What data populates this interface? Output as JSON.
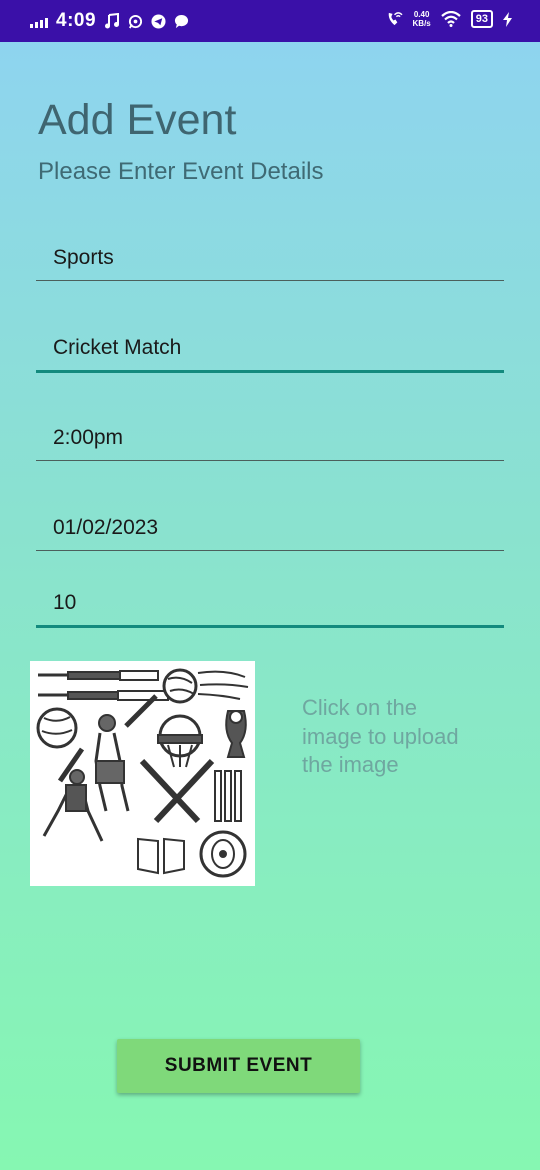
{
  "status_bar": {
    "time": "4:09",
    "net_speed_value": "0.40",
    "net_speed_unit": "KB/s",
    "battery": "93",
    "icons": [
      "signal-icon",
      "music-icon",
      "whatsapp-icon",
      "telegram-icon",
      "chat-icon",
      "call-wifi-icon",
      "wifi-icon",
      "battery-icon",
      "charging-icon"
    ]
  },
  "header": {
    "title": "Add Event",
    "subtitle": "Please Enter Event Details"
  },
  "form": {
    "category": "Sports",
    "event_name": "Cricket Match",
    "time": "2:00pm",
    "date": "01/02/2023",
    "number": "10"
  },
  "image": {
    "icon": "cricket-equipment-illustration",
    "hint": "Click on the image to upload the image"
  },
  "submit_label": "SUBMIT EVENT",
  "colors": {
    "status_bar": "#3a10a8",
    "focus_line": "#138a7e",
    "button": "#7fd97a"
  }
}
